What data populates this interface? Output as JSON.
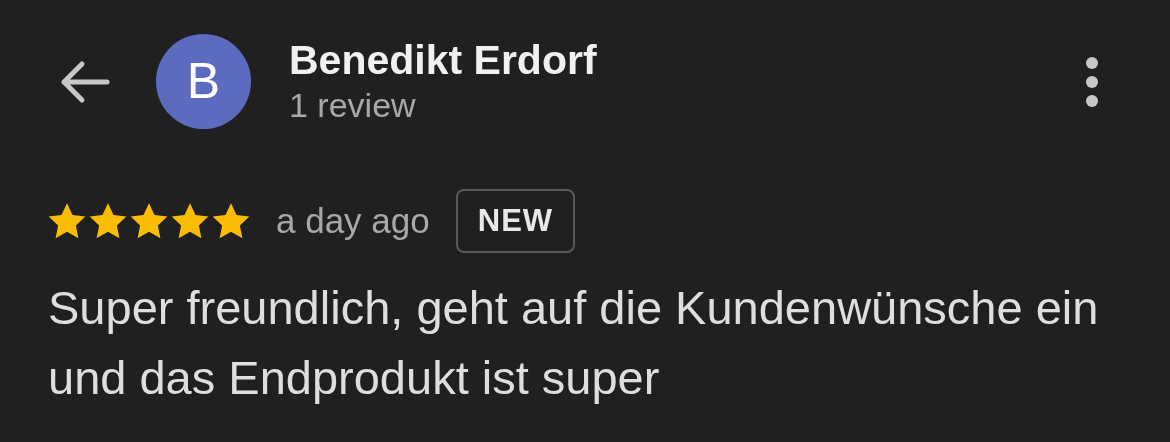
{
  "header": {
    "avatar_letter": "B",
    "name": "Benedikt Erdorf",
    "subtitle": "1 review"
  },
  "review": {
    "stars": 5,
    "time": "a day ago",
    "badge": "NEW",
    "text": "Super freundlich, geht auf die Kundenwünsche ein und das Endprodukt ist super"
  }
}
